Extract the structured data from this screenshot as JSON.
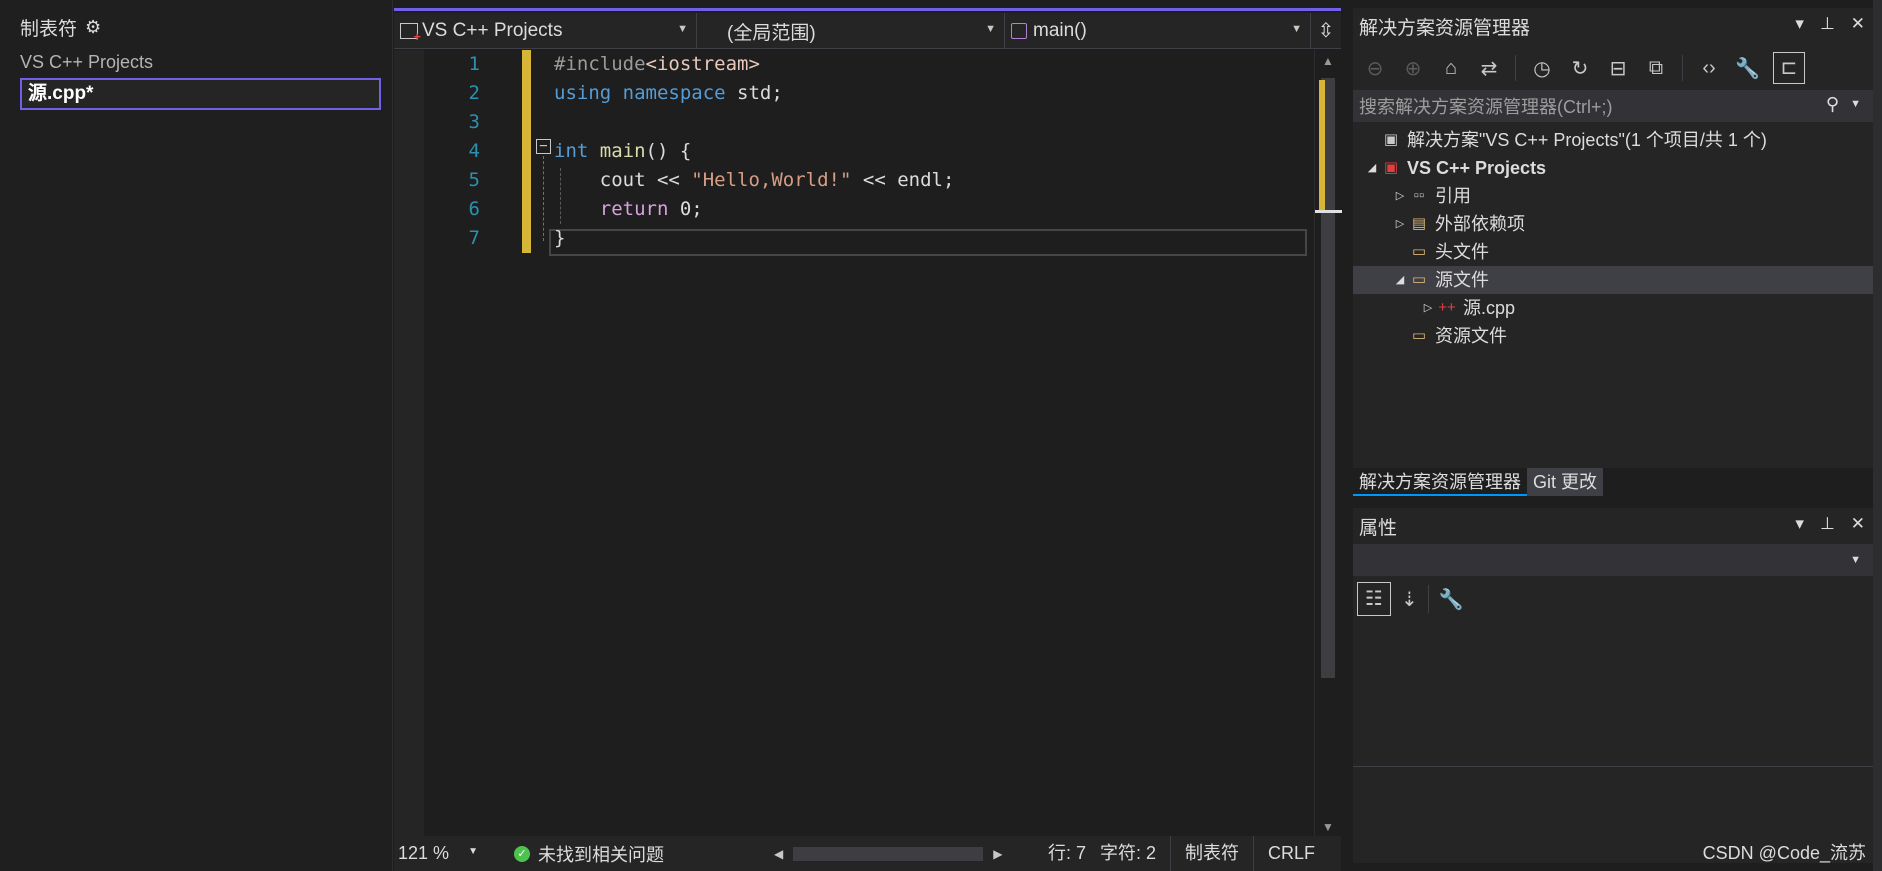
{
  "left_panel": {
    "title": "制表符",
    "project": "VS C++ Projects",
    "open_file": "源.cpp*"
  },
  "nav": {
    "project": "VS C++ Projects",
    "scope": "(全局范围)",
    "function": "main()"
  },
  "editor": {
    "line_numbers": [
      "1",
      "2",
      "3",
      "4",
      "5",
      "6",
      "7"
    ],
    "lines": {
      "l1_a": "#include",
      "l1_b": "<iostream>",
      "l2_a": "using",
      "l2_b": " namespace",
      "l2_c": " std;",
      "l4_a": "int",
      "l4_b": " main",
      "l4_c": "() {",
      "l5_a": "    cout << ",
      "l5_b": "\"Hello,World!\"",
      "l5_c": " << endl;",
      "l6_a": "    return",
      "l6_b": " 0;",
      "l7": "}"
    }
  },
  "status_bar": {
    "zoom": "121 %",
    "issues": "未找到相关问题",
    "line": "行: 7",
    "char": "字符: 2",
    "tabs": "制表符",
    "eol": "CRLF"
  },
  "solution_explorer": {
    "title": "解决方案资源管理器",
    "search_placeholder": "搜索解决方案资源管理器(Ctrl+;)",
    "tree": {
      "solution": "解决方案\"VS C++ Projects\"(1 个项目/共 1 个)",
      "project": "VS C++ Projects",
      "references": "引用",
      "external_deps": "外部依赖项",
      "headers": "头文件",
      "sources": "源文件",
      "source_file": "源.cpp",
      "resources": "资源文件"
    }
  },
  "panel_tabs": {
    "solution_explorer": "解决方案资源管理器",
    "git_changes": "Git 更改"
  },
  "properties": {
    "title": "属性"
  },
  "watermark": "CSDN @Code_流苏",
  "colors": {
    "accent": "#7160e8",
    "change_marker": "#d7b537",
    "line_number": "#2b91af",
    "keyword": "#569cd6",
    "string": "#d69d85"
  }
}
